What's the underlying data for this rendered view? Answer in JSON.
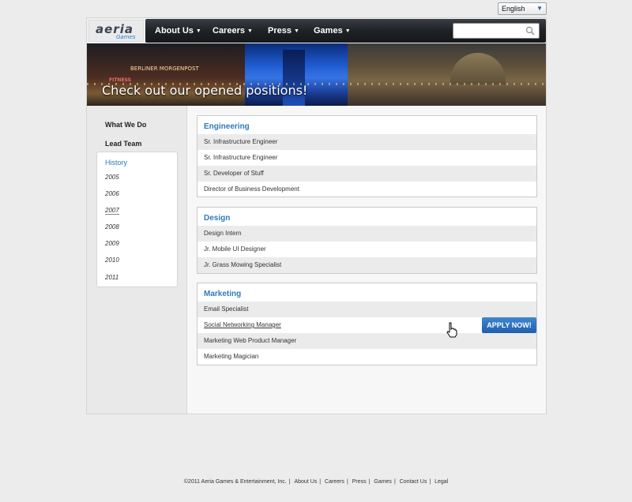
{
  "language_select": {
    "value": "English"
  },
  "logo": {
    "wordmark": "aeria",
    "sub": "Games"
  },
  "nav": {
    "items": [
      "About Us",
      "Careers",
      "Press",
      "Games"
    ]
  },
  "search": {
    "placeholder": ""
  },
  "banner": {
    "title": "Check out our opened positions!",
    "sign": "BERLINER MORGENPOST",
    "fitness": "FITNESS"
  },
  "sidebar": {
    "links": [
      "What We Do",
      "Lead Team"
    ],
    "history_title": "History",
    "years": [
      "2005",
      "2006",
      "2007",
      "2008",
      "2009",
      "2010",
      "2011"
    ]
  },
  "departments": [
    {
      "name": "Engineering",
      "jobs": [
        "Sr. Infrastructure Engineer",
        "Sr. Infrastructure Engineer",
        "Sr. Developer of Stuff",
        "Director of Business Development"
      ]
    },
    {
      "name": "Design",
      "jobs": [
        "Design Intern",
        "Jr. Mobile UI Designer",
        "Jr. Grass Mowing Specialist"
      ]
    },
    {
      "name": "Marketing",
      "jobs": [
        "Email Specialist",
        "Social Networking Manager",
        "Marketing Web Product Manager",
        "Marketing Magician"
      ]
    }
  ],
  "apply_button": "APPLY NOW!",
  "footer": {
    "copyright": "©2011 Aeria Games & Entertainment, Inc.",
    "links": [
      "About Us",
      "Careers",
      "Press",
      "Games",
      "Contact Us",
      "Legal"
    ]
  }
}
